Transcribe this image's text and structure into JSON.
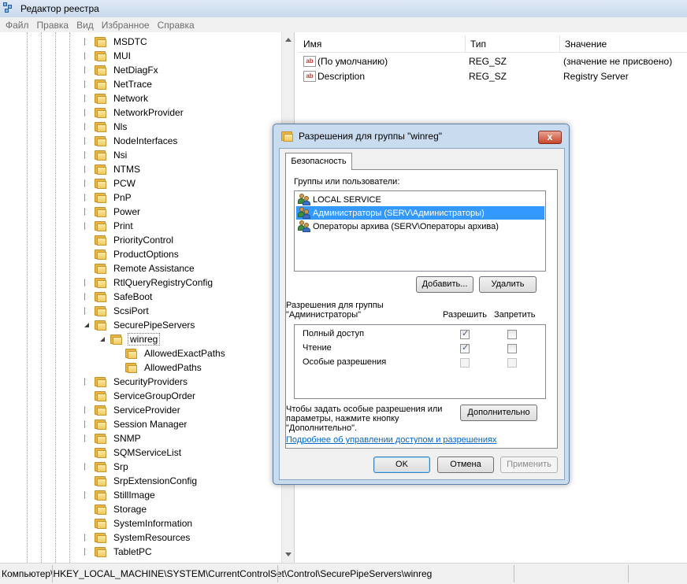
{
  "window": {
    "title": "Редактор реестра"
  },
  "menu": [
    "Файл",
    "Правка",
    "Вид",
    "Избранное",
    "Справка"
  ],
  "tree": {
    "items": [
      {
        "label": "MSDTC",
        "level": 0,
        "state": "closed"
      },
      {
        "label": "MUI",
        "level": 0,
        "state": "closed"
      },
      {
        "label": "NetDiagFx",
        "level": 0,
        "state": "closed"
      },
      {
        "label": "NetTrace",
        "level": 0,
        "state": "closed"
      },
      {
        "label": "Network",
        "level": 0,
        "state": "closed"
      },
      {
        "label": "NetworkProvider",
        "level": 0,
        "state": "closed"
      },
      {
        "label": "Nls",
        "level": 0,
        "state": "closed"
      },
      {
        "label": "NodeInterfaces",
        "level": 0,
        "state": "closed"
      },
      {
        "label": "Nsi",
        "level": 0,
        "state": "closed"
      },
      {
        "label": "NTMS",
        "level": 0,
        "state": "closed"
      },
      {
        "label": "PCW",
        "level": 0,
        "state": "closed"
      },
      {
        "label": "PnP",
        "level": 0,
        "state": "closed"
      },
      {
        "label": "Power",
        "level": 0,
        "state": "closed"
      },
      {
        "label": "Print",
        "level": 0,
        "state": "closed"
      },
      {
        "label": "PriorityControl",
        "level": 0,
        "state": "none"
      },
      {
        "label": "ProductOptions",
        "level": 0,
        "state": "none"
      },
      {
        "label": "Remote Assistance",
        "level": 0,
        "state": "none"
      },
      {
        "label": "RtlQueryRegistryConfig",
        "level": 0,
        "state": "closed"
      },
      {
        "label": "SafeBoot",
        "level": 0,
        "state": "closed"
      },
      {
        "label": "ScsiPort",
        "level": 0,
        "state": "closed"
      },
      {
        "label": "SecurePipeServers",
        "level": 0,
        "state": "open"
      },
      {
        "label": "winreg",
        "level": 1,
        "state": "open",
        "selected": true
      },
      {
        "label": "AllowedExactPaths",
        "level": 2,
        "state": "none"
      },
      {
        "label": "AllowedPaths",
        "level": 2,
        "state": "none"
      },
      {
        "label": "SecurityProviders",
        "level": 0,
        "state": "closed"
      },
      {
        "label": "ServiceGroupOrder",
        "level": 0,
        "state": "none"
      },
      {
        "label": "ServiceProvider",
        "level": 0,
        "state": "closed"
      },
      {
        "label": "Session Manager",
        "level": 0,
        "state": "closed"
      },
      {
        "label": "SNMP",
        "level": 0,
        "state": "closed"
      },
      {
        "label": "SQMServiceList",
        "level": 0,
        "state": "none"
      },
      {
        "label": "Srp",
        "level": 0,
        "state": "closed"
      },
      {
        "label": "SrpExtensionConfig",
        "level": 0,
        "state": "none"
      },
      {
        "label": "StillImage",
        "level": 0,
        "state": "closed"
      },
      {
        "label": "Storage",
        "level": 0,
        "state": "none"
      },
      {
        "label": "SystemInformation",
        "level": 0,
        "state": "none"
      },
      {
        "label": "SystemResources",
        "level": 0,
        "state": "closed"
      },
      {
        "label": "TabletPC",
        "level": 0,
        "state": "closed"
      }
    ]
  },
  "list": {
    "columns": [
      "Имя",
      "Тип",
      "Значение"
    ],
    "rows": [
      {
        "name": "(По умолчанию)",
        "type": "REG_SZ",
        "value": "(значение не присвоено)"
      },
      {
        "name": "Description",
        "type": "REG_SZ",
        "value": "Registry Server"
      }
    ]
  },
  "status": {
    "path": "Компьютер\\HKEY_LOCAL_MACHINE\\SYSTEM\\CurrentControlSet\\Control\\SecurePipeServers\\winreg"
  },
  "dialog": {
    "title": "Разрешения для группы \"winreg\"",
    "close_label": "x",
    "tab": "Безопасность",
    "groups_label": "Группы или пользователи:",
    "users": [
      {
        "name": "LOCAL SERVICE",
        "selected": false
      },
      {
        "name": "Администраторы (SERV\\Администраторы)",
        "selected": true
      },
      {
        "name": "Операторы архива (SERV\\Операторы архива)",
        "selected": false
      }
    ],
    "add_button": "Добавить...",
    "remove_button": "Удалить",
    "perm_label_1": "Разрешения для группы",
    "perm_label_2": "\"Администраторы\"",
    "allow_label": "Разрешить",
    "deny_label": "Запретить",
    "permissions": [
      {
        "name": "Полный доступ",
        "allow": true,
        "deny": false,
        "disabled": false
      },
      {
        "name": "Чтение",
        "allow": true,
        "deny": false,
        "disabled": false
      },
      {
        "name": "Особые разрешения",
        "allow": false,
        "deny": false,
        "disabled": true
      }
    ],
    "special_text_1": "Чтобы задать особые разрешения или",
    "special_text_2": "параметры, нажмите кнопку",
    "special_text_3": "\"Дополнительно\".",
    "advanced_button": "Дополнительно",
    "link": "Подробнее об управлении доступом и разрешениях",
    "ok_button": "OK",
    "cancel_button": "Отмена",
    "apply_button": "Применить"
  }
}
